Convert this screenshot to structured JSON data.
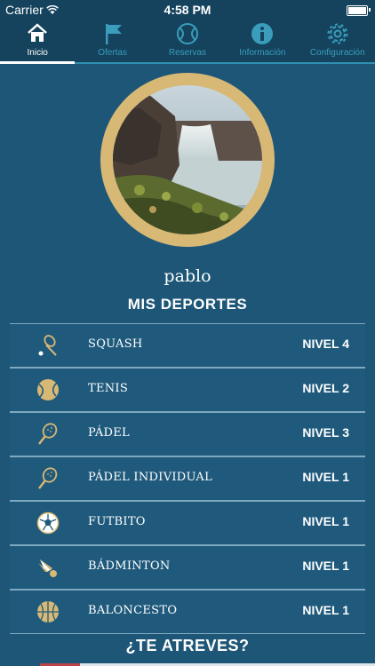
{
  "status_bar": {
    "carrier": "Carrier",
    "time": "4:58 PM"
  },
  "tabs": [
    {
      "label": "Inicio",
      "icon": "home-icon",
      "active": true
    },
    {
      "label": "Ofertas",
      "icon": "flag-icon",
      "active": false
    },
    {
      "label": "Reservas",
      "icon": "tennis-ball-icon",
      "active": false
    },
    {
      "label": "Información",
      "icon": "info-icon",
      "active": false
    },
    {
      "label": "Configuración",
      "icon": "gear-icon",
      "active": false
    }
  ],
  "profile": {
    "username": "pablo",
    "avatar": "waterfall-photo"
  },
  "sports_title": "MIS DEPORTES",
  "sports": [
    {
      "name": "SQUASH",
      "level": "NIVEL 4",
      "icon": "squash-racket-icon"
    },
    {
      "name": "TENIS",
      "level": "NIVEL 2",
      "icon": "tennis-ball-icon"
    },
    {
      "name": "PÁDEL",
      "level": "NIVEL 3",
      "icon": "padel-racket-icon"
    },
    {
      "name": "PÁDEL INDIVIDUAL",
      "level": "NIVEL 1",
      "icon": "padel-racket-icon"
    },
    {
      "name": "FUTBITO",
      "level": "NIVEL 1",
      "icon": "soccer-ball-icon"
    },
    {
      "name": "BÁDMINTON",
      "level": "NIVEL 1",
      "icon": "shuttlecock-icon"
    },
    {
      "name": "BALONCESTO",
      "level": "NIVEL 1",
      "icon": "basketball-icon"
    }
  ],
  "cta": "¿TE ATREVES?",
  "colors": {
    "background": "#1d5677",
    "accent_gold": "#d8b875",
    "tab_inactive": "#3a9dbb",
    "tab_bar": "#15435d"
  }
}
